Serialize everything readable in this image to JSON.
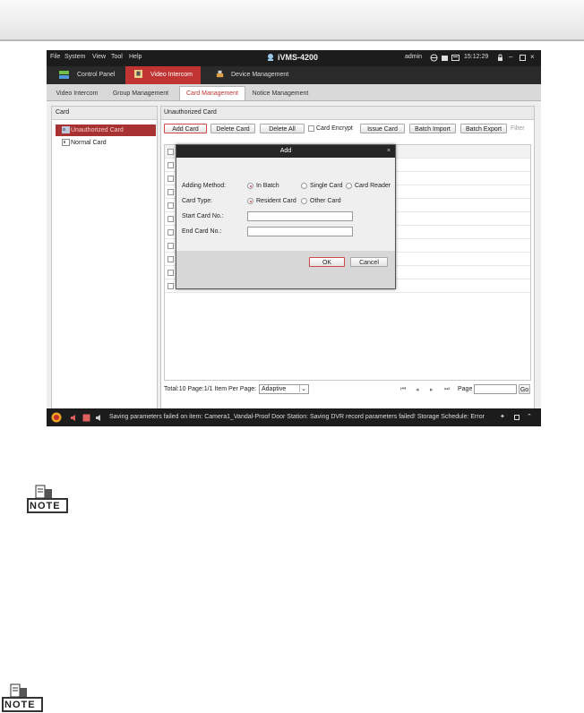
{
  "menu": [
    "File",
    "System",
    "View",
    "Tool",
    "Help"
  ],
  "app_title": "iVMS-4200",
  "status_right": {
    "user": "admin",
    "time": "15:12:29"
  },
  "modules": [
    {
      "label": "Control Panel"
    },
    {
      "label": "Video Intercom"
    },
    {
      "label": "Device Management"
    }
  ],
  "tabs": [
    "Video Intercom",
    "Group Management",
    "Card Management",
    "Notice Management"
  ],
  "left_panel": {
    "header": "Card",
    "items": [
      "Unauthorized Card",
      "Normal Card"
    ]
  },
  "right_panel": {
    "header": "Unauthorized Card",
    "toolbar": {
      "add": "Add Card",
      "delete": "Delete Card",
      "delete_all": "Delete All",
      "encrypt": "Card Encrypt",
      "issue": "Issue Card",
      "batch_import": "Batch Import",
      "batch_export": "Batch Export",
      "filter": "Filter"
    }
  },
  "footer": {
    "total": "Total:10  Page:1/1  Item Per Page:",
    "per_page": "Adaptive",
    "page_label": "Page",
    "go": "Go"
  },
  "status_message": "Saving parameters failed on item: Camera1_Vandal-Proof Door Station: Saving DVR record parameters failed! Storage Schedule: Error Code ...",
  "dialog": {
    "title": "Add",
    "adding_method_label": "Adding Method:",
    "methods": [
      "In Batch",
      "Single Card",
      "Card Reader"
    ],
    "card_type_label": "Card Type:",
    "card_types": [
      "Resident Card",
      "Other Card"
    ],
    "start_label": "Start Card No.:",
    "end_label": "End Card No.:",
    "ok": "OK",
    "cancel": "Cancel"
  },
  "note_label": "NOTE",
  "colors": {
    "accent": "#c03434",
    "menubar": "#1c1c1c"
  }
}
